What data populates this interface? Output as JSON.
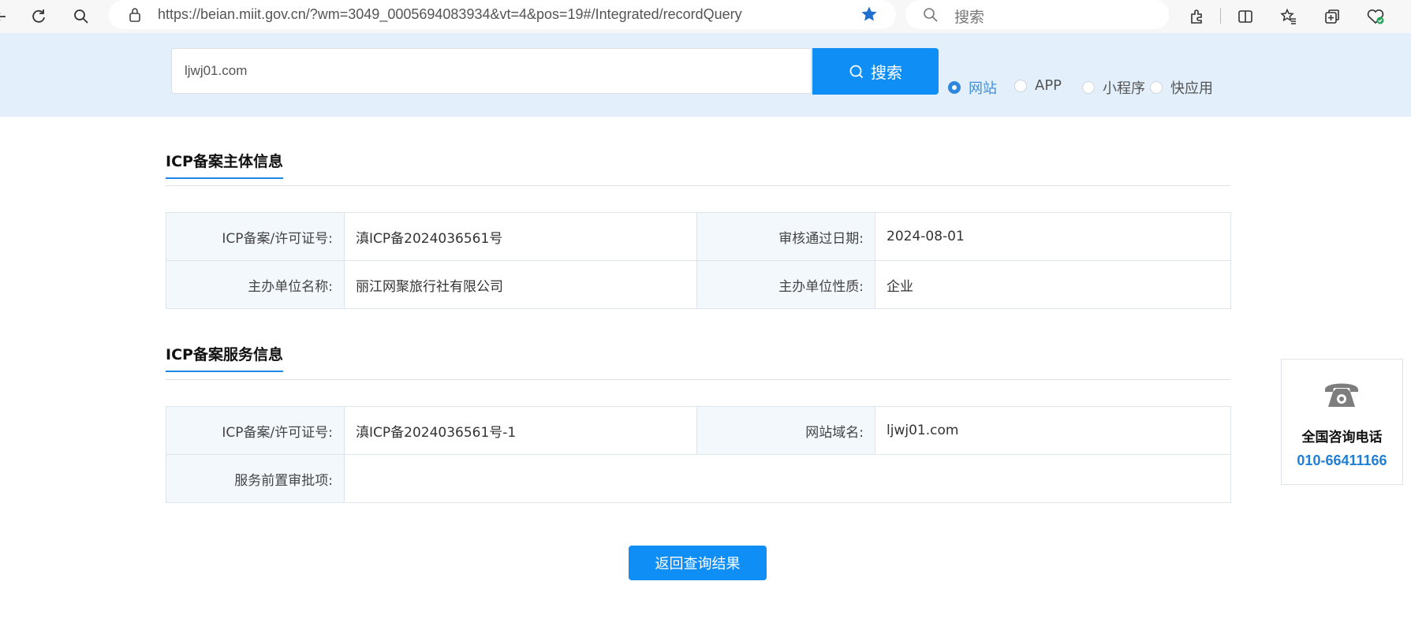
{
  "browser": {
    "url": "https://beian.miit.gov.cn/?wm=3049_0005694083934&vt=4&pos=19#/Integrated/recordQuery",
    "search_placeholder": "搜索",
    "icons": [
      "back-icon",
      "refresh-icon",
      "search-icon",
      "lock-icon",
      "favorite-star-icon",
      "extensions-icon",
      "split-screen-icon",
      "favorites-icon",
      "collections-icon",
      "health-icon"
    ]
  },
  "search": {
    "query": "ljwj01.com",
    "button_label": "搜索",
    "types": [
      {
        "label": "网站",
        "checked": true
      },
      {
        "label": "APP",
        "checked": false
      },
      {
        "label": "小程序",
        "checked": false
      },
      {
        "label": "快应用",
        "checked": false
      }
    ]
  },
  "subject_section": {
    "title": "ICP备案主体信息",
    "rows": [
      {
        "label1": "ICP备案/许可证号:",
        "value1": "滇ICP备2024036561号",
        "label2": "审核通过日期:",
        "value2": "2024-08-01"
      },
      {
        "label1": "主办单位名称:",
        "value1": "丽江网聚旅行社有限公司",
        "label2": "主办单位性质:",
        "value2": "企业"
      }
    ]
  },
  "service_section": {
    "title": "ICP备案服务信息",
    "row1": {
      "label1": "ICP备案/许可证号:",
      "value1": "滇ICP备2024036561号-1",
      "label2": "网站域名:",
      "value2": "ljwj01.com"
    },
    "row2": {
      "label": "服务前置审批项:",
      "value": ""
    }
  },
  "back_button": "返回查询结果",
  "contact": {
    "title": "全国咨询电话",
    "phone": "010-66411166",
    "accent_color": "#1e7fd8"
  },
  "colors": {
    "primary": "#0f8ef6",
    "banner_bg": "#e3f0fc",
    "label_bg": "#f3f8fd"
  }
}
